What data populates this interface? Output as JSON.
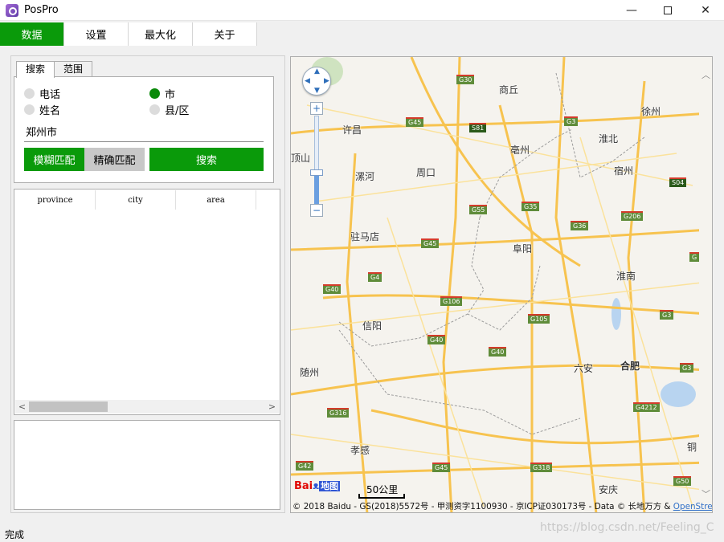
{
  "window": {
    "title": "PosPro",
    "minimize": "—",
    "close": "✕"
  },
  "menu": {
    "items": [
      "数据",
      "设置",
      "最大化",
      "关于"
    ]
  },
  "search_panel": {
    "tabs": [
      "搜索",
      "范围"
    ],
    "radios": [
      {
        "label": "电话",
        "selected": false
      },
      {
        "label": "市",
        "selected": true
      },
      {
        "label": "姓名",
        "selected": false
      },
      {
        "label": "县/区",
        "selected": false
      }
    ],
    "query_value": "郑州市",
    "fuzzy_button": "模糊匹配",
    "exact_button": "精确匹配",
    "search_button": "搜索"
  },
  "result_table": {
    "columns": [
      "province",
      "city",
      "area"
    ],
    "scroll_left": "<",
    "scroll_right": ">"
  },
  "map": {
    "cities": [
      {
        "name": "许昌",
        "kind": "city"
      },
      {
        "name": "商丘",
        "kind": "city"
      },
      {
        "name": "徐州",
        "kind": "city"
      },
      {
        "name": "顶山",
        "kind": "city"
      },
      {
        "name": "漯河",
        "kind": "city"
      },
      {
        "name": "周口",
        "kind": "city"
      },
      {
        "name": "亳州",
        "kind": "city"
      },
      {
        "name": "淮北",
        "kind": "city"
      },
      {
        "name": "宿州",
        "kind": "city"
      },
      {
        "name": "驻马店",
        "kind": "city"
      },
      {
        "name": "阜阳",
        "kind": "city"
      },
      {
        "name": "淮南",
        "kind": "city"
      },
      {
        "name": "信阳",
        "kind": "city"
      },
      {
        "name": "六安",
        "kind": "city"
      },
      {
        "name": "合肥",
        "kind": "capital"
      },
      {
        "name": "随州",
        "kind": "city"
      },
      {
        "name": "孝感",
        "kind": "city"
      },
      {
        "name": "安庆",
        "kind": "city"
      },
      {
        "name": "铜",
        "kind": "city"
      }
    ],
    "shields": [
      "G30",
      "G45",
      "S81",
      "G3",
      "S04",
      "G55",
      "G35",
      "G36",
      "G206",
      "G45",
      "G4",
      "G40",
      "G106",
      "G105",
      "G3",
      "G40",
      "G40",
      "G3",
      "G316",
      "G4212",
      "G42",
      "G45",
      "G318",
      "G50",
      "G"
    ],
    "zoom_in": "+",
    "zoom_out": "−",
    "logo_text": "Bai",
    "logo_paw": "ᴥ",
    "logo_du": "地图",
    "scale": "50公里",
    "copyright": "© 2018 Baidu - GS(2018)5572号 - 甲测资字1100930 - 京ICP证030173号 - Data © 长地万方 & ",
    "copyright_link": "OpenStreet",
    "scroll_up": "︿",
    "scroll_down": "﹀"
  },
  "status": {
    "text": "完成"
  },
  "watermark": "https://blog.csdn.net/Feeling_C",
  "colors": {
    "accent_green": "#0a9a0a",
    "road_yellow": "#f7c34f",
    "map_bg": "#f5f3ee"
  }
}
